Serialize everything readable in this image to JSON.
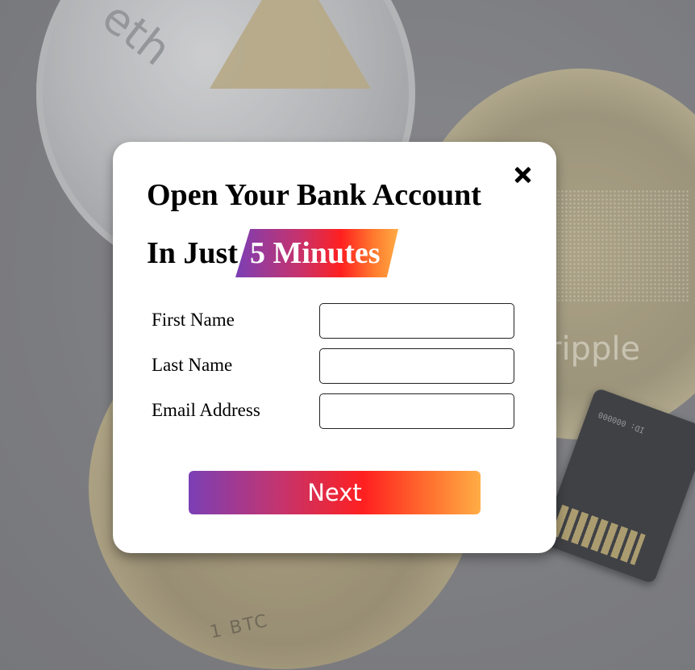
{
  "background": {
    "coin_eth_text": "eth",
    "coin_xrp_text": "ripple",
    "coin_btc_text": "1 BTC",
    "sdcard_text": "ID: 000000",
    "icons": [
      "ethereum-coin",
      "ripple-coin",
      "bitcoin-coin",
      "sd-card"
    ]
  },
  "modal": {
    "close_icon": "close-icon",
    "title_line1": "Open Your Bank Account",
    "title_line2_prefix": "In Just",
    "title_highlight": "5 Minutes",
    "fields": [
      {
        "label": "First Name",
        "value": "",
        "placeholder": ""
      },
      {
        "label": "Last Name",
        "value": "",
        "placeholder": ""
      },
      {
        "label": "Email Address",
        "value": "",
        "placeholder": ""
      }
    ],
    "next_label": "Next"
  },
  "colors": {
    "gradient_start": "#7b3fb5",
    "gradient_mid": "#ff2020",
    "gradient_end": "#ffad45",
    "modal_bg": "#ffffff"
  }
}
